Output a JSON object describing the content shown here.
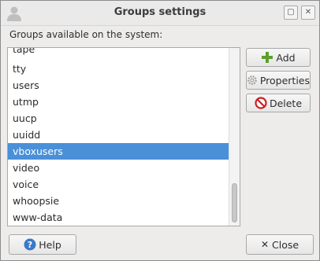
{
  "window": {
    "title": "Groups settings",
    "icon": "users-icon"
  },
  "caption": "Groups available on the system:",
  "groups": [
    "tape",
    "tty",
    "users",
    "utmp",
    "uucp",
    "uuidd",
    "vboxusers",
    "video",
    "voice",
    "whoopsie",
    "www-data"
  ],
  "selected_group": "vboxusers",
  "buttons": {
    "add": {
      "label": "Add",
      "icon": "plus-icon"
    },
    "properties": {
      "label": "Properties",
      "icon": "gear-icon"
    },
    "delete": {
      "label": "Delete",
      "icon": "no-entry-icon"
    },
    "help": {
      "label": "Help",
      "icon": "help-icon"
    },
    "close": {
      "label": "Close",
      "icon": "close-x-icon"
    }
  },
  "colors": {
    "selection": "#4a90d9",
    "add_icon": "#5aa02c",
    "delete_icon": "#cc1f1f",
    "help_icon": "#3a78c9"
  }
}
